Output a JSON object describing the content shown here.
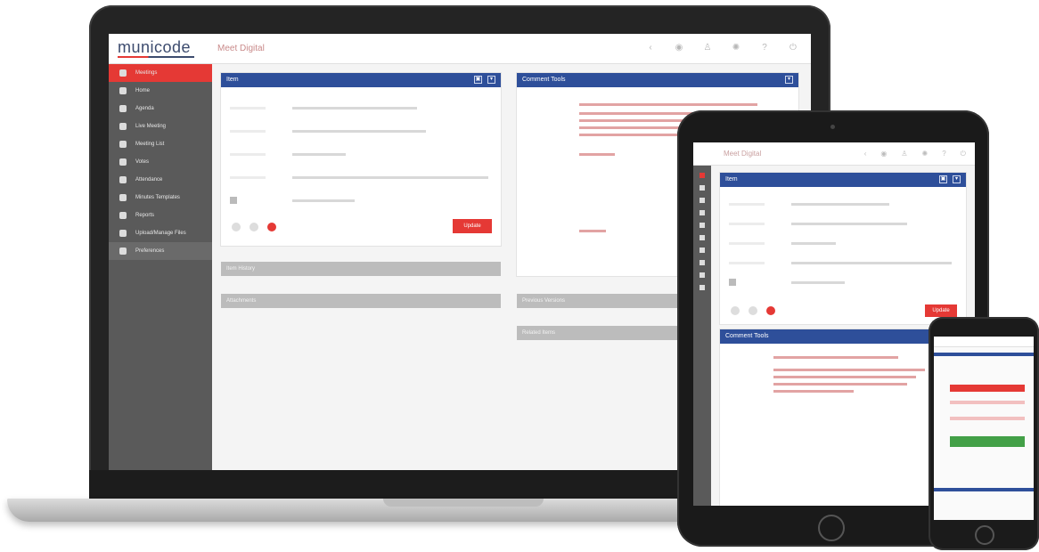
{
  "laptop": {
    "logo": "municode",
    "app_title": "Meet Digital",
    "header_icons": [
      "back-icon",
      "settings-icon",
      "user-icon",
      "gear-icon",
      "help-icon",
      "power-icon"
    ],
    "sidebar": {
      "items": [
        {
          "label": "Meetings",
          "icon": "calendar-icon",
          "active": true
        },
        {
          "label": "Home",
          "icon": "home-icon"
        },
        {
          "label": "Agenda",
          "icon": "agenda-icon"
        },
        {
          "label": "Live Meeting",
          "icon": "live-icon"
        },
        {
          "label": "Meeting List",
          "icon": "list-icon"
        },
        {
          "label": "Votes",
          "icon": "vote-icon"
        },
        {
          "label": "Attendance",
          "icon": "attendance-icon"
        },
        {
          "label": "Minutes Templates",
          "icon": "template-icon"
        },
        {
          "label": "Reports",
          "icon": "report-icon"
        },
        {
          "label": "Upload/Manage Files",
          "icon": "upload-icon"
        },
        {
          "label": "Preferences",
          "icon": "preferences-icon"
        }
      ]
    },
    "panels": {
      "item": {
        "title": "Item",
        "update_label": "Update"
      },
      "comment": {
        "title": "Comment Tools"
      },
      "bar1": {
        "title": "Item History"
      },
      "bar2": {
        "title": "Attachments"
      },
      "bar3": {
        "title": "Previous Versions"
      },
      "bar4": {
        "title": "Related Items"
      }
    }
  },
  "tablet": {
    "app_title": "Meet Digital",
    "panels": {
      "item": {
        "title": "Item",
        "update_label": "Update"
      },
      "comment": {
        "title": "Comment Tools"
      }
    }
  },
  "colors": {
    "brand_red": "#e53935",
    "brand_blue": "#2e4f9a",
    "sidebar": "#5a5a5a",
    "green": "#43a047"
  }
}
